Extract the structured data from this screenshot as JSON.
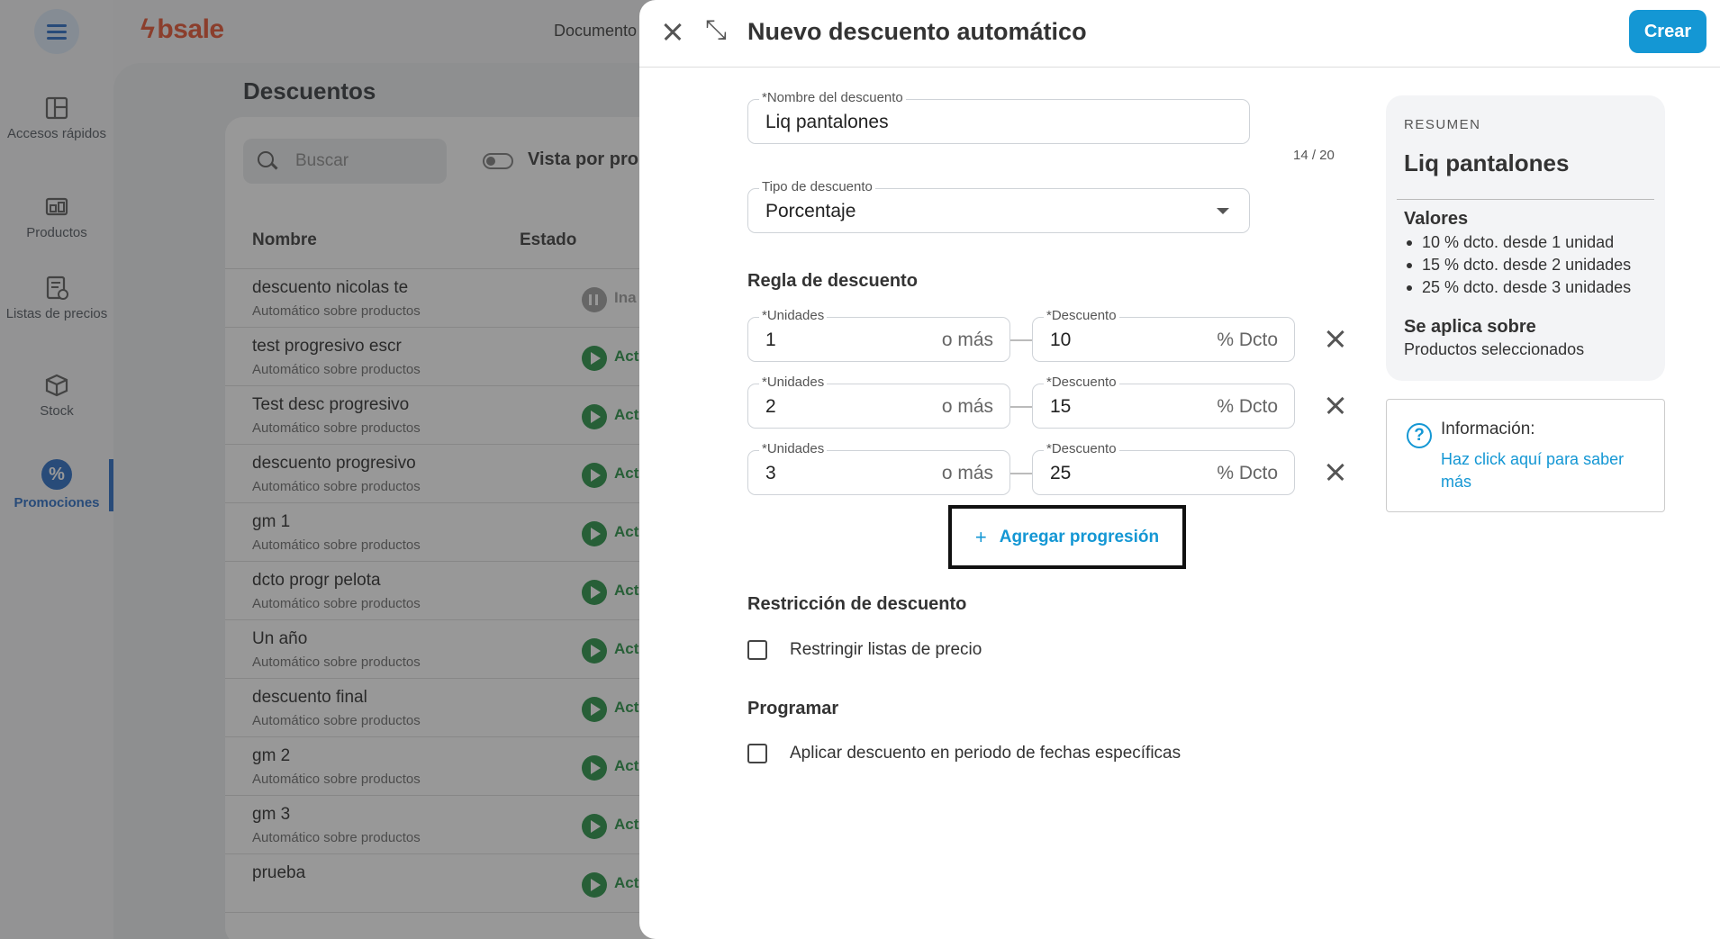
{
  "sidebar": {
    "items": [
      {
        "label": "Accesos rápidos",
        "icon": "grid-icon"
      },
      {
        "label": "Productos",
        "icon": "products-icon"
      },
      {
        "label": "Listas de precios",
        "icon": "price-list-icon"
      },
      {
        "label": "Stock",
        "icon": "box-icon"
      },
      {
        "label": "Promociones",
        "icon": "percent-icon"
      }
    ]
  },
  "topbar": {
    "logo": "bsale",
    "documents": "Documento"
  },
  "background": {
    "title": "Descuentos",
    "search_placeholder": "Buscar",
    "toggle_label": "Vista por pro",
    "columns": [
      "Nombre",
      "Estado"
    ],
    "rows": [
      {
        "name": "descuento nicolas te",
        "sub": "Automático sobre productos",
        "status": "Ina",
        "paused": true
      },
      {
        "name": "test progresivo escr",
        "sub": "Automático sobre productos",
        "status": "Act",
        "paused": false
      },
      {
        "name": "Test desc progresivo",
        "sub": "Automático sobre productos",
        "status": "Act",
        "paused": false
      },
      {
        "name": "descuento progresivo",
        "sub": "Automático sobre productos",
        "status": "Act",
        "paused": false
      },
      {
        "name": "gm 1",
        "sub": "Automático sobre productos",
        "status": "Act",
        "paused": false
      },
      {
        "name": "dcto progr pelota",
        "sub": "Automático sobre productos",
        "status": "Act",
        "paused": false
      },
      {
        "name": "Un año",
        "sub": "Automático sobre productos",
        "status": "Act",
        "paused": false
      },
      {
        "name": "descuento final",
        "sub": "Automático sobre productos",
        "status": "Act",
        "paused": false
      },
      {
        "name": "gm 2",
        "sub": "Automático sobre productos",
        "status": "Act",
        "paused": false
      },
      {
        "name": "gm 3",
        "sub": "Automático sobre productos",
        "status": "Act",
        "paused": false
      },
      {
        "name": "prueba",
        "sub": "",
        "status": "Act",
        "paused": false
      }
    ]
  },
  "drawer": {
    "title": "Nuevo descuento automático",
    "create_label": "Crear",
    "name_field": {
      "label": "*Nombre del descuento",
      "value": "Liq pantalones",
      "counter": "14 / 20"
    },
    "type_field": {
      "label": "Tipo de descuento",
      "value": "Porcentaje"
    },
    "rule_title": "Regla de descuento",
    "rules": [
      {
        "units_label": "*Unidades",
        "units": "1",
        "units_suffix": "o más",
        "disc_label": "*Descuento",
        "disc": "10",
        "disc_suffix": "% Dcto"
      },
      {
        "units_label": "*Unidades",
        "units": "2",
        "units_suffix": "o más",
        "disc_label": "*Descuento",
        "disc": "15",
        "disc_suffix": "% Dcto"
      },
      {
        "units_label": "*Unidades",
        "units": "3",
        "units_suffix": "o más",
        "disc_label": "*Descuento",
        "disc": "25",
        "disc_suffix": "% Dcto"
      }
    ],
    "add_progression": "Agregar progresión",
    "restriction_title": "Restricción de descuento",
    "restriction_check": "Restringir listas de precio",
    "schedule_title": "Programar",
    "schedule_check": "Aplicar descuento en periodo de fechas específicas"
  },
  "summary": {
    "heading": "RESUMEN",
    "name": "Liq pantalones",
    "values_title": "Valores",
    "values": [
      "10 % dcto. desde 1 unidad",
      "15 % dcto. desde 2 unidades",
      "25 % dcto. desde 3 unidades"
    ],
    "applies_title": "Se aplica sobre",
    "applies_value": "Productos seleccionados"
  },
  "info": {
    "title": "Información:",
    "link": "Haz click aquí para saber más"
  },
  "colors": {
    "accent": "#1497d4",
    "brand": "#e44b27",
    "nav_active": "#1f64c0",
    "active_status": "#1c8c3c"
  }
}
